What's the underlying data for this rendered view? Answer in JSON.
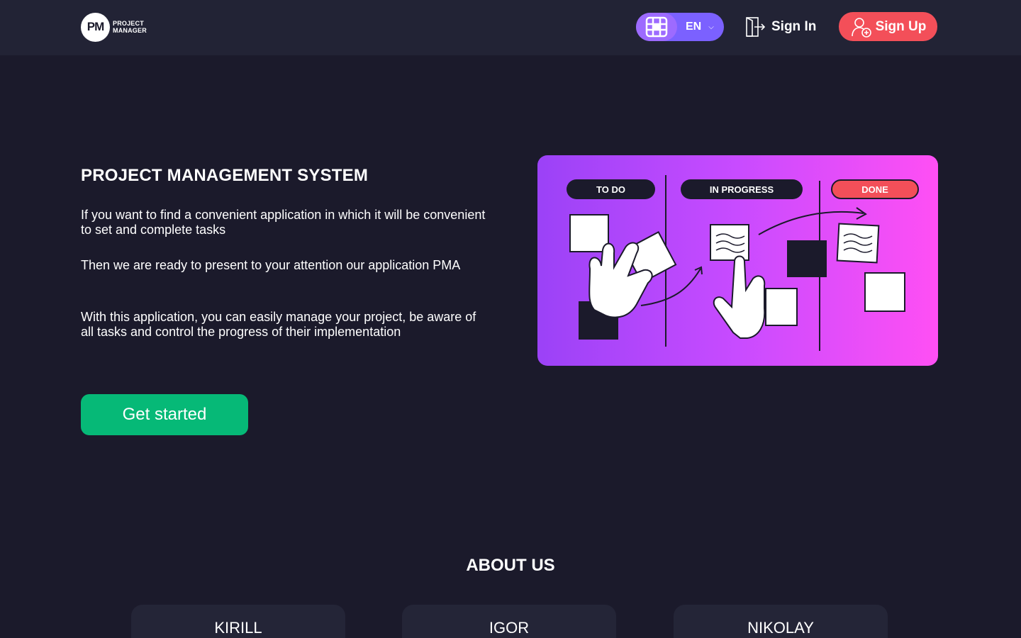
{
  "header": {
    "logo_mark": "PM",
    "logo_line1": "PROJECT",
    "logo_line2": "MANAGER",
    "language": "EN",
    "signin_label": "Sign In",
    "signup_label": "Sign Up"
  },
  "hero": {
    "title": "PROJECT MANAGEMENT SYSTEM",
    "paragraph1": "If you want to find a convenient application in which it will be convenient to set and complete tasks",
    "paragraph2": "Then we are ready to present to your attention our application PMA",
    "paragraph3": "With this application, you can easily manage your project, be aware of all tasks and control the progress of their implementation",
    "cta_label": "Get started"
  },
  "board": {
    "columns": [
      "TO DO",
      "IN PROGRESS",
      "DONE"
    ]
  },
  "about": {
    "title": "ABOUT US",
    "members": [
      "KIRILL",
      "IGOR",
      "NIKOLAY"
    ]
  },
  "colors": {
    "background": "#1b1a2b",
    "header": "#222335",
    "accent_purple": "#7b61ff",
    "signup": "#f34f59",
    "cta": "#06b977"
  }
}
